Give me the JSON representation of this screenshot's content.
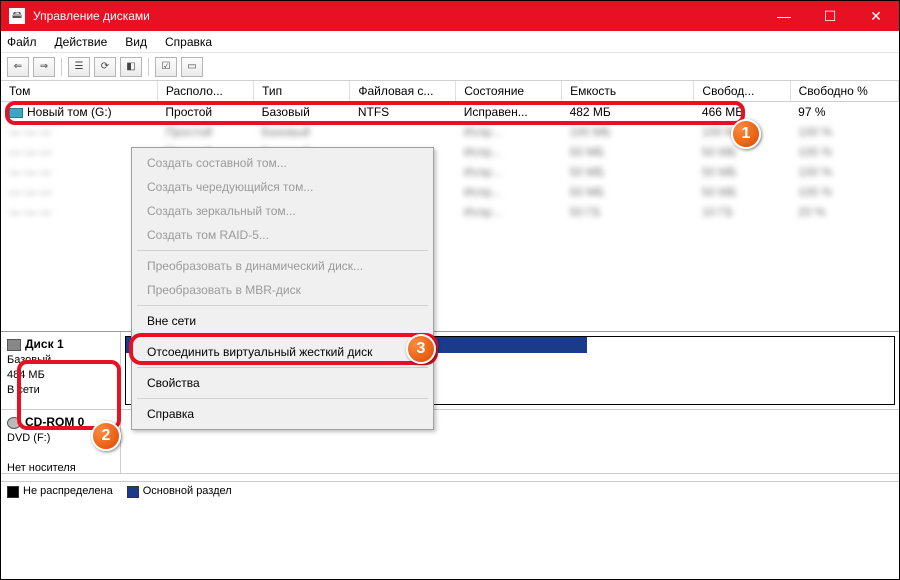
{
  "window": {
    "title": "Управление дисками"
  },
  "menu": {
    "file": "Файл",
    "action": "Действие",
    "view": "Вид",
    "help": "Справка"
  },
  "columns": {
    "volume": "Том",
    "layout": "Располо...",
    "type": "Тип",
    "fs": "Файловая с...",
    "status": "Состояние",
    "capacity": "Емкость",
    "free": "Свобод...",
    "free_pct": "Свободно %"
  },
  "row1": {
    "volume": "Новый том (G:)",
    "layout": "Простой",
    "type": "Базовый",
    "fs": "NTFS",
    "status": "Исправен...",
    "capacity": "482 МБ",
    "free": "466 МБ",
    "free_pct": "97 %"
  },
  "ctx": {
    "i1": "Создать составной том...",
    "i2": "Создать чередующийся том...",
    "i3": "Создать зеркальный том...",
    "i4": "Создать том RAID-5...",
    "i5": "Преобразовать в динамический диск...",
    "i6": "Преобразовать в MBR-диск",
    "i7": "Вне сети",
    "i8": "Отсоединить виртуальный жесткий диск",
    "i9": "Свойства",
    "i10": "Справка"
  },
  "disk": {
    "head": "Диск 1",
    "type": "Базовый",
    "size": "484 МБ",
    "state": "В сети"
  },
  "cdrom": {
    "head": "CD-ROM 0",
    "dev": "DVD (F:)",
    "state": "Нет носителя"
  },
  "legend": {
    "unalloc": "Не распределена",
    "primary": "Основной раздел"
  },
  "badges": {
    "b1": "1",
    "b2": "2",
    "b3": "3"
  }
}
